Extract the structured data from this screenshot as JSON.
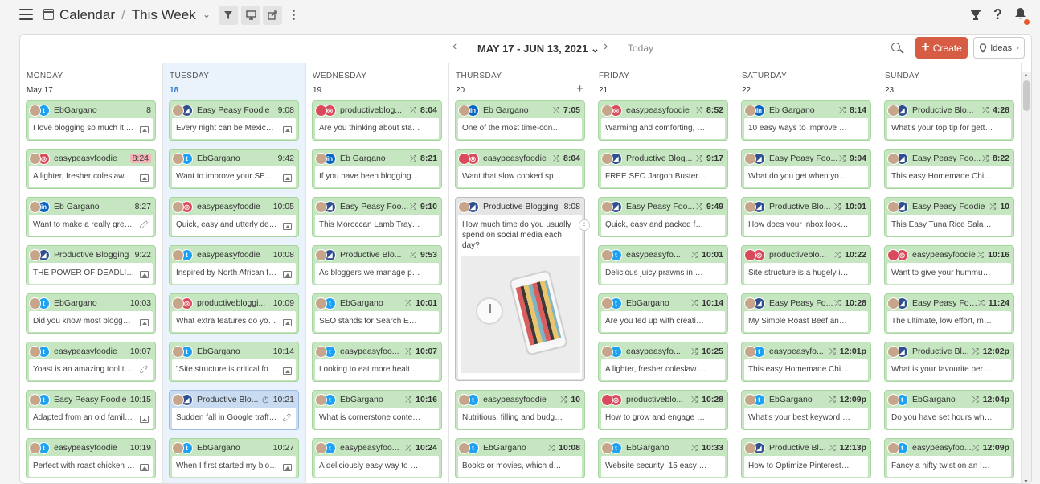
{
  "header": {
    "app": "Calendar",
    "separator": "/",
    "view": "This Week",
    "view_chevron": "⌄",
    "filter_icon": "filter-icon",
    "preview_icon": "monitor-icon",
    "share_icon": "share-icon"
  },
  "toolbar": {
    "range": "MAY 17 - JUN 13, 2021",
    "range_chevron": "⌄",
    "today": "Today",
    "create": "Create",
    "ideas": "Ideas"
  },
  "colors": {
    "accent": "#d65c43",
    "card_green": "#c5e6c0",
    "card_blue": "#c9dbf1",
    "today_blue": "#3a7bc8"
  },
  "days": [
    {
      "name": "MONDAY",
      "date": "May 17",
      "today": false,
      "posts": [
        {
          "net": "tw",
          "acct": "EbGargano",
          "time": "8",
          "text": "I love blogging so much it n...",
          "icon": "image"
        },
        {
          "net": "ig",
          "acct": "easypeasyfoodie",
          "time": "8:24",
          "text": "A lighter, fresher coleslaw...",
          "icon": "image",
          "late": true
        },
        {
          "net": "li",
          "acct": "Eb Gargano",
          "time": "8:27",
          "text": "Want to make a really great...",
          "icon": "link"
        },
        {
          "net": "pb",
          "acct": "Productive Blogging",
          "time": "9:22",
          "text": "THE POWER OF DEADLIN...",
          "icon": "image"
        },
        {
          "net": "tw",
          "acct": "EbGargano",
          "time": "10:03",
          "text": "Did you know most blogger...",
          "icon": "image"
        },
        {
          "net": "tw",
          "acct": "easypeasyfoodie",
          "time": "10:07",
          "text": "Yoast is an amazing tool th...",
          "icon": "link"
        },
        {
          "net": "tw",
          "acct": "Easy Peasy Foodie",
          "time": "10:15",
          "text": "Adapted from an old family ...",
          "icon": "image"
        },
        {
          "net": "tw",
          "acct": "easypeasyfoodie",
          "time": "10:19",
          "text": "Perfect with roast chicken o...",
          "icon": "image"
        }
      ]
    },
    {
      "name": "TUESDAY",
      "date": "18",
      "today": true,
      "posts": [
        {
          "net": "pb",
          "acct": "Easy Peasy Foodie",
          "time": "9:08",
          "text": "Every night can be Mexican...",
          "icon": "image"
        },
        {
          "net": "tw",
          "acct": "EbGargano",
          "time": "9:42",
          "text": "Want to improve your SEO, ...",
          "icon": "image"
        },
        {
          "net": "ig",
          "acct": "easypeasyfoodie",
          "time": "10:05",
          "text": "Quick, easy and utterly deli...",
          "icon": "image"
        },
        {
          "net": "tw",
          "acct": "easypeasyfoodie",
          "time": "10:08",
          "text": "Inspired by North African fla...",
          "icon": "image"
        },
        {
          "net": "ig",
          "acct": "productivebloggi...",
          "time": "10:09",
          "text": "What extra features do you ...",
          "icon": "image"
        },
        {
          "net": "tw",
          "acct": "EbGargano",
          "time": "10:14",
          "text": "\"Site structure is critical for ...",
          "icon": "image"
        },
        {
          "net": "pb",
          "acct": "Productive Blo...",
          "time": "10:21",
          "text": "Sudden fall in Google traffic...",
          "icon": "link",
          "selected": true,
          "clock": true
        },
        {
          "net": "tw",
          "acct": "EbGargano",
          "time": "10:27",
          "text": "When I first started my blog...",
          "icon": "image"
        }
      ]
    },
    {
      "name": "WEDNESDAY",
      "date": "19",
      "today": false,
      "posts": [
        {
          "net": "ig",
          "acct": "productiveblog...",
          "time": "8:04",
          "text": "Are you thinking about starting...",
          "sched": true,
          "red": true
        },
        {
          "net": "li",
          "acct": "Eb Gargano",
          "time": "8:21",
          "text": "If you have been blogging for s...",
          "sched": true
        },
        {
          "net": "pb",
          "acct": "Easy Peasy Foo...",
          "time": "9:10",
          "text": "This Moroccan Lamb Traybak...",
          "sched": true
        },
        {
          "net": "pb",
          "acct": "Productive Blo...",
          "time": "9:53",
          "text": "As bloggers we manage proje...",
          "sched": true
        },
        {
          "net": "tw",
          "acct": "EbGargano",
          "time": "10:01",
          "text": "SEO stands for Search Engine...",
          "sched": true
        },
        {
          "net": "tw",
          "acct": "easypeasyfoo...",
          "time": "10:07",
          "text": "Looking to eat more healthily t...",
          "sched": true
        },
        {
          "net": "tw",
          "acct": "EbGargano",
          "time": "10:16",
          "text": "What is cornerstone content? ...",
          "sched": true
        },
        {
          "net": "tw",
          "acct": "easypeasyfoo...",
          "time": "10:24",
          "text": "A deliciously easy way to use ...",
          "sched": true
        }
      ]
    },
    {
      "name": "THURSDAY",
      "date": "20",
      "today": false,
      "posts": [
        {
          "net": "li",
          "acct": "Eb Gargano",
          "time": "7:05",
          "text": "One of the most time-consumi...",
          "sched": true
        },
        {
          "net": "ig",
          "acct": "easypeasyfoodie",
          "time": "8:04",
          "text": "Want that slow cooked spaghe...",
          "sched": true,
          "red": true
        },
        {
          "net": "pb",
          "acct": "Productive Blogging",
          "time": "8:08",
          "text": "How much time do you usually spend on social media each day?",
          "big": true
        },
        {
          "net": "tw",
          "acct": "easypeasyfoodie",
          "time": "10",
          "text": "Nutritious, filling and budget-fri...",
          "sched": true
        },
        {
          "net": "tw",
          "acct": "EbGargano",
          "time": "10:08",
          "text": "Books or movies, which do yo...",
          "sched": true
        }
      ]
    },
    {
      "name": "FRIDAY",
      "date": "21",
      "today": false,
      "posts": [
        {
          "net": "ig",
          "acct": "easypeasyfoodie",
          "time": "8:52",
          "text": "Warming and comforting, my E...",
          "sched": true
        },
        {
          "net": "pb",
          "acct": "Productive Blog...",
          "time": "9:17",
          "text": "FREE SEO Jargon Buster for ...",
          "sched": true
        },
        {
          "net": "pb",
          "acct": "Easy Peasy Foo...",
          "time": "9:49",
          "text": "Quick, easy and packed full of ...",
          "sched": true
        },
        {
          "net": "tw",
          "acct": "easypeasyfo...",
          "time": "10:01",
          "text": "Delicious juicy prawns in a coc...",
          "sched": true
        },
        {
          "net": "tw",
          "acct": "EbGargano",
          "time": "10:14",
          "text": "Are you fed up with creating c...",
          "sched": true
        },
        {
          "net": "tw",
          "acct": "easypeasyfo...",
          "time": "10:25",
          "text": "A lighter, fresher coleslaw....th...",
          "sched": true
        },
        {
          "net": "ig",
          "acct": "productiveblo...",
          "time": "10:28",
          "text": "How to grow and engage a cle...",
          "sched": true,
          "red": true
        },
        {
          "net": "tw",
          "acct": "EbGargano",
          "time": "10:33",
          "text": "Website security: 15 easy way...",
          "sched": true
        }
      ]
    },
    {
      "name": "SATURDAY",
      "date": "22",
      "today": false,
      "posts": [
        {
          "net": "li",
          "acct": "Eb Gargano",
          "time": "8:14",
          "text": "10 easy ways to improve your ...",
          "sched": true
        },
        {
          "net": "pb",
          "acct": "Easy Peasy Foo...",
          "time": "9:04",
          "text": "What do you get when you cro...",
          "sched": true
        },
        {
          "net": "pb",
          "acct": "Productive Blo...",
          "time": "10:01",
          "text": "How does your inbox look right...",
          "sched": true
        },
        {
          "net": "ig",
          "acct": "productiveblo...",
          "time": "10:22",
          "text": "Site structure is a hugely impo...",
          "sched": true,
          "red": true
        },
        {
          "net": "pb",
          "acct": "Easy Peasy Fo...",
          "time": "10:28",
          "text": "My Simple Roast Beef and Mi...",
          "sched": true
        },
        {
          "net": "tw",
          "acct": "easypeasyfo...",
          "time": "12:01p",
          "text": "This easy Homemade Chicken...",
          "sched": true
        },
        {
          "net": "tw",
          "acct": "EbGargano",
          "time": "12:09p",
          "text": "What's your best keyword rese...",
          "sched": true
        },
        {
          "net": "pb",
          "acct": "Productive Bl...",
          "time": "12:13p",
          "text": "How to Optimize Pinterest Boa...",
          "sched": true
        }
      ]
    },
    {
      "name": "SUNDAY",
      "date": "23",
      "today": false,
      "posts": [
        {
          "net": "pb",
          "acct": "Productive Blo...",
          "time": "4:28",
          "text": "What's your top tip for getting t...",
          "sched": true
        },
        {
          "net": "pb",
          "acct": "Easy Peasy Foo...",
          "time": "8:22",
          "text": "This easy Homemade Chicken ...",
          "sched": true
        },
        {
          "net": "pb",
          "acct": "Easy Peasy Foodie",
          "time": "10",
          "text": "This Easy Tuna Rice Salad is ...",
          "sched": true
        },
        {
          "net": "ig",
          "acct": "easypeasyfoodie",
          "time": "10:16",
          "text": "Want to give your hummus a c...",
          "sched": true,
          "red": true
        },
        {
          "net": "pb",
          "acct": "Easy Peasy Foo...",
          "time": "11:24",
          "text": "The ultimate, low effort, maxim...",
          "sched": true
        },
        {
          "net": "pb",
          "acct": "Productive Bl...",
          "time": "12:02p",
          "text": "What is your favourite persona...",
          "sched": true
        },
        {
          "net": "tw",
          "acct": "EbGargano",
          "time": "12:04p",
          "text": "Do you have set hours when y...",
          "sched": true
        },
        {
          "net": "tw",
          "acct": "easypeasyfoo...",
          "time": "12:09p",
          "text": "Fancy a nifty twist on an Indian...",
          "sched": true
        }
      ]
    }
  ],
  "network_glyphs": {
    "tw": "t",
    "ig": "◎",
    "li": "in",
    "pb": "◢"
  },
  "sched_glyph": "⤮",
  "add_glyph": "+",
  "more_glyph": "⋮"
}
